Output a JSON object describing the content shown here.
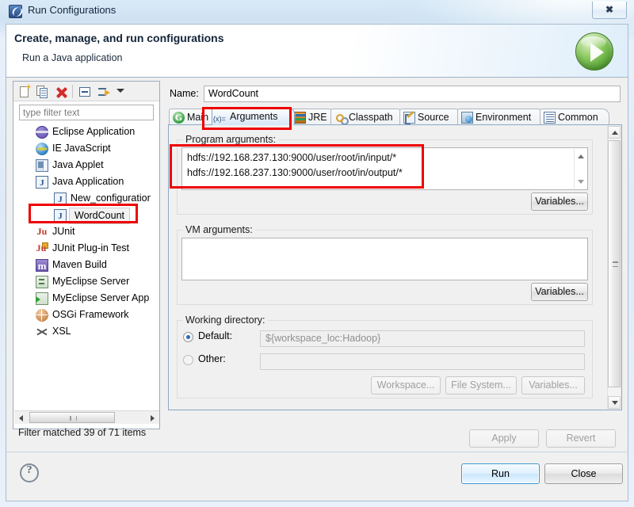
{
  "window": {
    "title": "Run Configurations",
    "icon": "eclipse-run-icon",
    "close_label": "✖"
  },
  "header": {
    "title": "Create, manage, and run configurations",
    "subtitle": "Run a Java application",
    "orb_icon": "green-run-play-icon"
  },
  "left_panel": {
    "toolbar": [
      {
        "name": "new-configuration-button",
        "icon": "new-page-icon"
      },
      {
        "name": "duplicate-configuration-button",
        "icon": "duplicate-pages-icon"
      },
      {
        "name": "delete-configuration-button",
        "icon": "red-x-delete-icon"
      },
      {
        "name": "collapse-all-button",
        "icon": "collapse-all-icon"
      },
      {
        "name": "filter-configurations-button",
        "icon": "filter-arrows-icon"
      },
      {
        "name": "toolbar-menu-button",
        "icon": "chevron-down-icon"
      }
    ],
    "filter": {
      "placeholder": "type filter text",
      "value": ""
    },
    "tree": [
      {
        "label": "Eclipse Application",
        "icon": "eclipse-icon",
        "level": 1,
        "selected": false
      },
      {
        "label": "IE JavaScript",
        "icon": "ie-globe-icon",
        "level": 1,
        "selected": false
      },
      {
        "label": "Java Applet",
        "icon": "java-applet-icon",
        "level": 1,
        "selected": false
      },
      {
        "label": "Java Application",
        "icon": "java-icon",
        "level": 1,
        "selected": false
      },
      {
        "label": "New_configuration",
        "icon": "java-icon",
        "level": 2,
        "selected": false
      },
      {
        "label": "WordCount",
        "icon": "java-icon",
        "level": 2,
        "selected": true
      },
      {
        "label": "JUnit",
        "icon": "junit-icon",
        "level": 1,
        "selected": false
      },
      {
        "label": "JUnit Plug-in Test",
        "icon": "junit-plugin-icon",
        "level": 1,
        "selected": false
      },
      {
        "label": "Maven Build",
        "icon": "maven-icon",
        "level": 1,
        "selected": false
      },
      {
        "label": "MyEclipse Server",
        "icon": "server-icon",
        "level": 1,
        "selected": false
      },
      {
        "label": "MyEclipse Server App",
        "icon": "server-app-icon",
        "level": 1,
        "selected": false
      },
      {
        "label": "OSGi Framework",
        "icon": "osgi-icon",
        "level": 1,
        "selected": false
      },
      {
        "label": "XSL",
        "icon": "xsl-icon",
        "level": 1,
        "selected": false
      }
    ],
    "status": "Filter matched 39 of 71 items"
  },
  "right_panel": {
    "name_label": "Name:",
    "name_value": "WordCount",
    "tabs": [
      {
        "label": "Main",
        "icon": "main-tab-icon",
        "selected": false
      },
      {
        "label": "Arguments",
        "icon": "arguments-tab-icon",
        "selected": true
      },
      {
        "label": "JRE",
        "icon": "jre-tab-icon",
        "selected": false
      },
      {
        "label": "Classpath",
        "icon": "classpath-tab-icon",
        "selected": false
      },
      {
        "label": "Source",
        "icon": "source-tab-icon",
        "selected": false
      },
      {
        "label": "Environment",
        "icon": "environment-tab-icon",
        "selected": false
      },
      {
        "label": "Common",
        "icon": "common-tab-icon",
        "selected": false
      }
    ],
    "program_arguments": {
      "label": "Program arguments:",
      "line1": "hdfs://192.168.237.130:9000/user/root/in/input/*",
      "line2": "hdfs://192.168.237.130:9000/user/root/in/output/*",
      "variables_button": "Variables..."
    },
    "vm_arguments": {
      "label": "VM arguments:",
      "value": "",
      "variables_button": "Variables..."
    },
    "working_directory": {
      "label": "Working directory:",
      "default_label": "Default:",
      "default_value": "${workspace_loc:Hadoop}",
      "default_selected": true,
      "other_label": "Other:",
      "other_value": "",
      "other_selected": false,
      "workspace_button": "Workspace...",
      "file_system_button": "File System...",
      "variables_button": "Variables..."
    },
    "apply_button": "Apply",
    "revert_button": "Revert"
  },
  "footer": {
    "help_icon": "question-mark-help-icon",
    "run_button": "Run",
    "close_button": "Close"
  },
  "annotations": {
    "accent_color": "#ee0000",
    "boxes": [
      {
        "name": "arguments-tab-highlight"
      },
      {
        "name": "wordcount-tree-item-highlight"
      },
      {
        "name": "program-arguments-highlight"
      }
    ]
  }
}
